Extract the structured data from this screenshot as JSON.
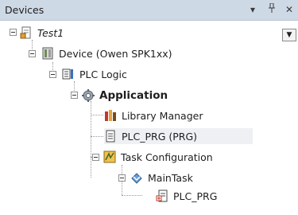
{
  "panel": {
    "title": "Devices",
    "dropdown_glyph": "▾",
    "pin_glyph": "ᵖ",
    "close_glyph": "✕",
    "tree_dropdown_glyph": "▼"
  },
  "tree": [
    {
      "label": "Test1",
      "icon": "project-icon",
      "expanded": true
    },
    {
      "label": "Device (Owen SPK1xx)",
      "icon": "device-icon",
      "expanded": true
    },
    {
      "label": "PLC Logic",
      "icon": "plc-logic-icon",
      "expanded": true
    },
    {
      "label": "Application",
      "icon": "application-gear-icon",
      "expanded": true
    },
    {
      "label": "Library Manager",
      "icon": "library-manager-icon"
    },
    {
      "label": "PLC_PRG (PRG)",
      "icon": "pou-icon",
      "selected": true
    },
    {
      "label": "Task Configuration",
      "icon": "task-configuration-icon",
      "expanded": true
    },
    {
      "label": "MainTask",
      "icon": "task-icon",
      "expanded": true
    },
    {
      "label": "PLC_PRG",
      "icon": "program-call-icon"
    }
  ]
}
